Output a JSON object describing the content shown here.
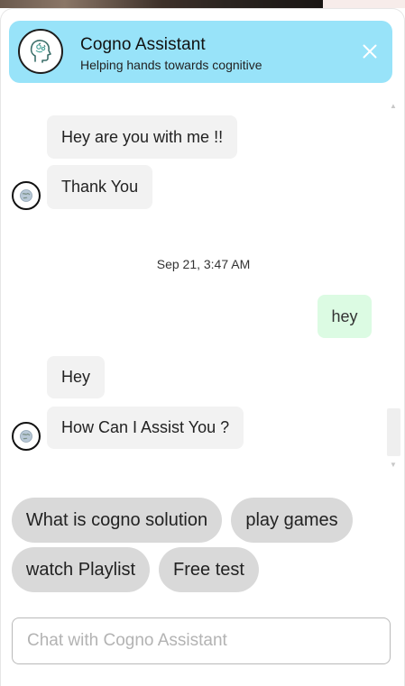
{
  "header": {
    "title": "Cogno Assistant",
    "subtitle": "Helping hands towards cognitive",
    "avatar_icon": "brain-head-icon",
    "close_icon": "close-icon"
  },
  "messages": [
    {
      "sender": "bot",
      "text": "Hey are you with me !!"
    },
    {
      "sender": "bot",
      "text": "Thank You"
    },
    {
      "sender": "system",
      "text": "Sep 21, 3:47 AM"
    },
    {
      "sender": "user",
      "text": "hey"
    },
    {
      "sender": "bot",
      "text": "Hey"
    },
    {
      "sender": "bot",
      "text": "How Can I Assist You ?"
    }
  ],
  "quick_replies": [
    "What is cogno solution",
    "play games",
    "watch Playlist",
    "Free test"
  ],
  "input": {
    "placeholder": "Chat with Cogno Assistant",
    "value": ""
  },
  "colors": {
    "header_bg": "#98e3f9",
    "bot_bubble": "#f2f2f2",
    "user_bubble": "#dcfbe3",
    "chip_bg": "#d9d9d9"
  }
}
